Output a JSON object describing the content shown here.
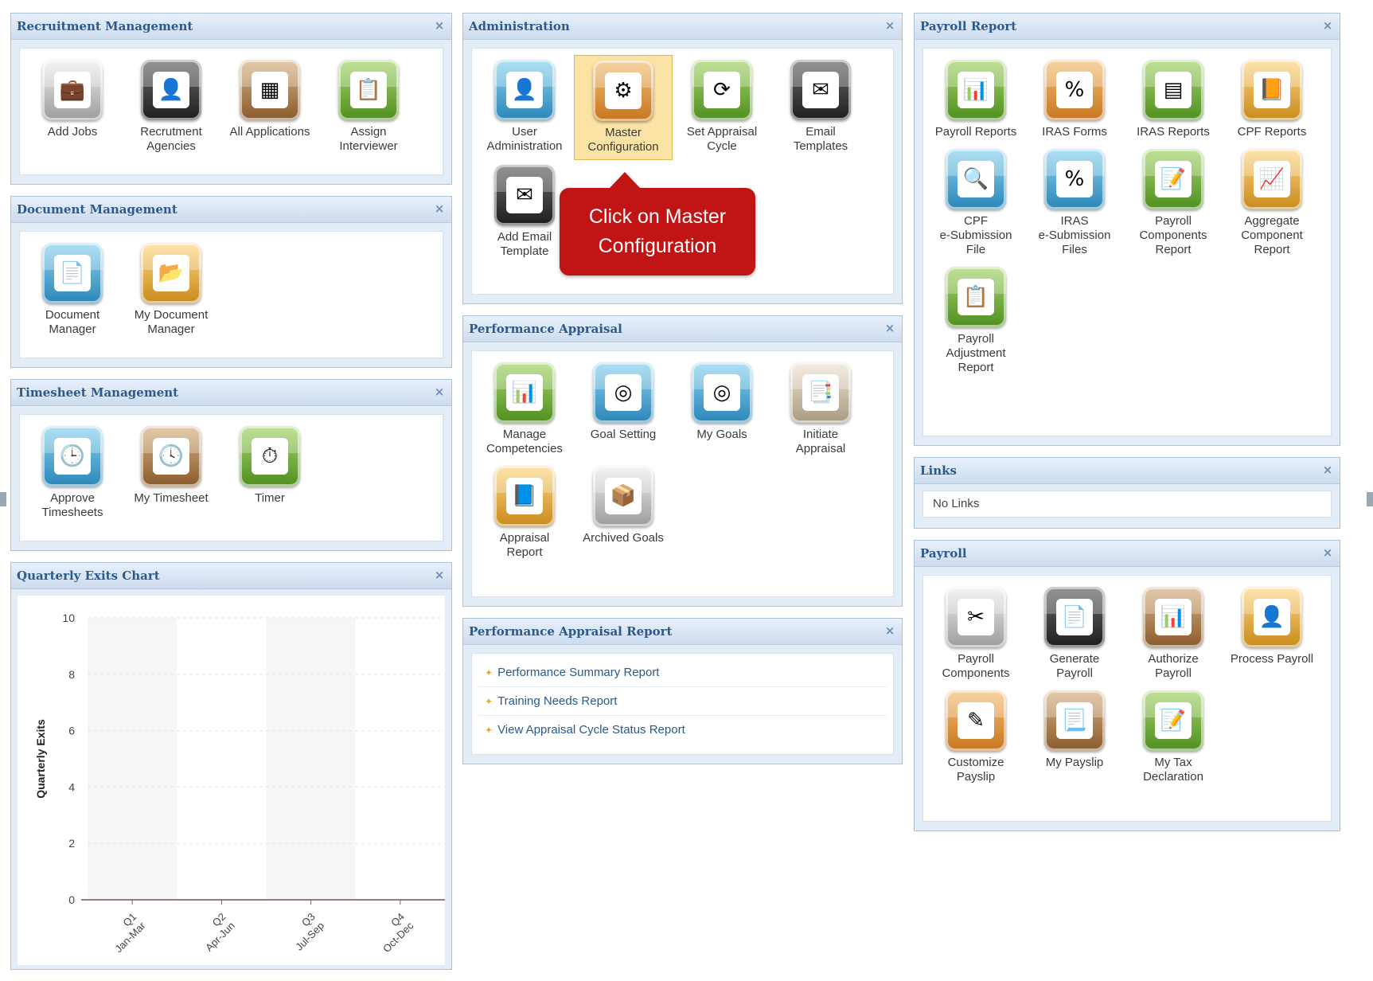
{
  "recruitment": {
    "title": "Recruitment Management",
    "items": [
      {
        "label": "Add Jobs",
        "icon": "briefcase-icon",
        "glyph": "💼"
      },
      {
        "label": "Recrutment\nAgencies",
        "icon": "person-icon",
        "glyph": "👤"
      },
      {
        "label": "All Applications",
        "icon": "calendar-grid-icon",
        "glyph": "▦"
      },
      {
        "label": "Assign\nInterviewer",
        "icon": "clipboard-pen-icon",
        "glyph": "📋"
      }
    ]
  },
  "document": {
    "title": "Document Management",
    "items": [
      {
        "label": "Document\nManager",
        "icon": "document-star-icon",
        "glyph": "📄"
      },
      {
        "label": "My Document\nManager",
        "icon": "folder-document-icon",
        "glyph": "📂"
      }
    ]
  },
  "timesheet": {
    "title": "Timesheet Management",
    "items": [
      {
        "label": "Approve\nTimesheets",
        "icon": "clock-check-icon",
        "glyph": "🕒"
      },
      {
        "label": "My Timesheet",
        "icon": "clock-person-icon",
        "glyph": "🕓"
      },
      {
        "label": "Timer",
        "icon": "stopwatch-icon",
        "glyph": "⏱"
      }
    ]
  },
  "quarterly": {
    "title": "Quarterly Exits Chart"
  },
  "administration": {
    "title": "Administration",
    "items": [
      {
        "label": "User\nAdministration",
        "icon": "user-icon",
        "glyph": "👤"
      },
      {
        "label": "Master\nConfiguration",
        "icon": "gear-icon",
        "glyph": "⚙"
      },
      {
        "label": "Set Appraisal\nCycle",
        "icon": "cycle-clock-icon",
        "glyph": "⟳"
      },
      {
        "label": "Email\nTemplates",
        "icon": "email-template-icon",
        "glyph": "✉"
      },
      {
        "label": "Add Email\nTemplate",
        "icon": "add-email-template-icon",
        "glyph": "✉"
      }
    ]
  },
  "callout": {
    "text": "Click on Master\nConfiguration"
  },
  "performance": {
    "title": "Performance Appraisal",
    "items": [
      {
        "label": "Manage\nCompetencies",
        "icon": "bar-chart-people-icon",
        "glyph": "📊"
      },
      {
        "label": "Goal Setting",
        "icon": "target-icon",
        "glyph": "◎"
      },
      {
        "label": "My Goals",
        "icon": "target-person-icon",
        "glyph": "◎"
      },
      {
        "label": "Initiate\nAppraisal",
        "icon": "appraisal-document-icon",
        "glyph": "📑"
      },
      {
        "label": "Appraisal\nReport",
        "icon": "report-icon",
        "glyph": "📘"
      },
      {
        "label": "Archived Goals",
        "icon": "archive-box-icon",
        "glyph": "📦"
      }
    ]
  },
  "perf_report": {
    "title": "Performance Appraisal Report",
    "items": [
      "Performance Summary Report",
      "Training Needs Report",
      "View Appraisal Cycle Status Report"
    ]
  },
  "payroll_report": {
    "title": "Payroll Report",
    "items": [
      {
        "label": "Payroll Reports",
        "icon": "chart-report-icon",
        "glyph": "📊"
      },
      {
        "label": "IRAS Forms",
        "icon": "percent-form-icon",
        "glyph": "%"
      },
      {
        "label": "IRAS Reports",
        "icon": "calculator-report-icon",
        "glyph": "▤"
      },
      {
        "label": "CPF Reports",
        "icon": "cpf-report-icon",
        "glyph": "📙"
      },
      {
        "label": "CPF\ne-Submission\nFile",
        "icon": "e-submission-icon",
        "glyph": "🔍"
      },
      {
        "label": "IRAS\ne-Submission\nFiles",
        "icon": "iras-submission-icon",
        "glyph": "%"
      },
      {
        "label": "Payroll\nComponents\nReport",
        "icon": "components-report-icon",
        "glyph": "📝"
      },
      {
        "label": "Aggregate\nComponent\nReport",
        "icon": "aggregate-report-icon",
        "glyph": "📈"
      },
      {
        "label": "Payroll\nAdjustment\nReport",
        "icon": "adjustment-report-icon",
        "glyph": "📋"
      }
    ]
  },
  "links": {
    "title": "Links",
    "text": "No Links"
  },
  "payroll": {
    "title": "Payroll",
    "items": [
      {
        "label": "Payroll\nComponents",
        "icon": "tools-icon",
        "glyph": "✂"
      },
      {
        "label": "Generate\nPayroll",
        "icon": "generate-document-icon",
        "glyph": "📄"
      },
      {
        "label": "Authorize\nPayroll",
        "icon": "authorize-chart-icon",
        "glyph": "📊"
      },
      {
        "label": "Process Payroll",
        "icon": "person-coins-icon",
        "glyph": "👤"
      },
      {
        "label": "Customize\nPayslip",
        "icon": "customize-payslip-icon",
        "glyph": "✎"
      },
      {
        "label": "My Payslip",
        "icon": "payslip-icon",
        "glyph": "📃"
      },
      {
        "label": "My Tax\nDeclaration",
        "icon": "tax-declaration-icon",
        "glyph": "📝"
      }
    ]
  },
  "chart_data": {
    "type": "bar",
    "categories": [
      "Q1\nJan-Mar",
      "Q2\nApr-Jun",
      "Q3\nJul-Sep",
      "Q4\nOct-Dec"
    ],
    "values": [
      0,
      0,
      0,
      0
    ],
    "title": "",
    "xlabel": "",
    "ylabel": "Quarterly Exits",
    "ylim": [
      0,
      10
    ],
    "yticks": [
      0,
      2,
      4,
      6,
      8,
      10
    ],
    "grid": true
  },
  "colors": {
    "accent": "#2c5a8c",
    "callout": "#c11414",
    "selected": "#fbe3a6"
  }
}
